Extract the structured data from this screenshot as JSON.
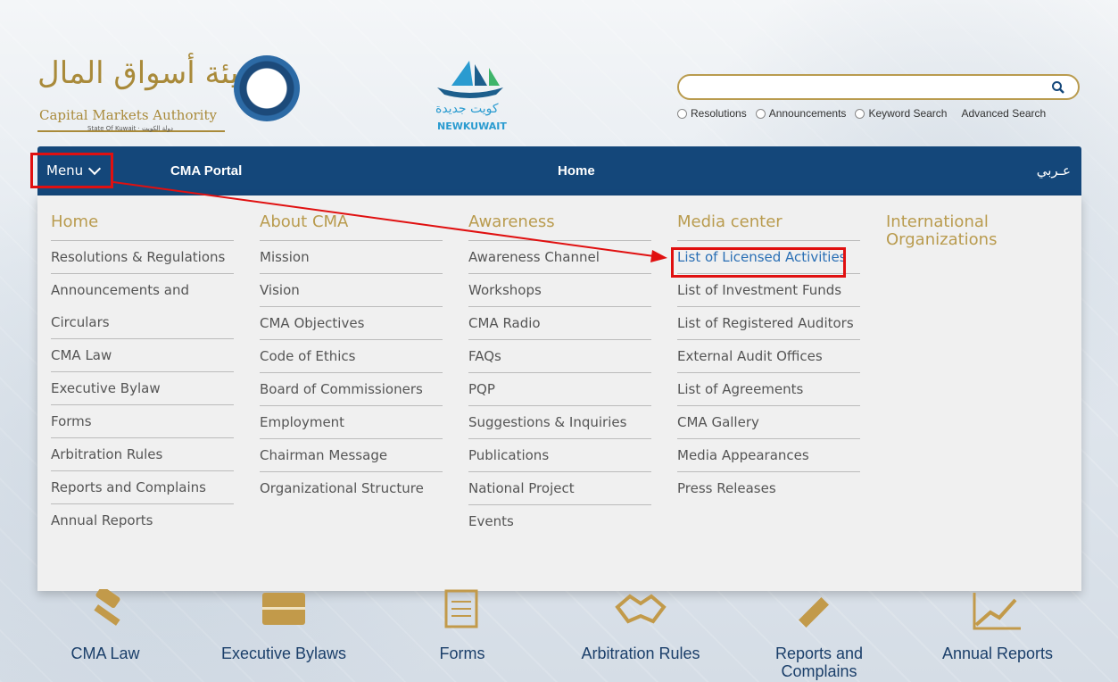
{
  "header": {
    "logo_ar": "هيئة أسواق المال",
    "logo_en": "Capital Markets Authority",
    "logo_sub": "State Of Kuwait · دولة الكويت",
    "newkuwait_ar": "كويت جديدة",
    "newkuwait_en": "NEWKUWAIT"
  },
  "search": {
    "placeholder": "",
    "options": [
      "Resolutions",
      "Announcements",
      "Keyword Search"
    ],
    "advanced": "Advanced Search"
  },
  "nav": {
    "menu": "Menu",
    "portal": "CMA Portal",
    "home": "Home",
    "arabic": "عـربي"
  },
  "dropdown": {
    "home": {
      "title": "Home",
      "items": [
        "Resolutions & Regulations",
        "Announcements and Circulars",
        "CMA Law",
        "Executive Bylaw",
        "Forms",
        "Arbitration Rules",
        "Reports and Complains",
        "Annual Reports"
      ]
    },
    "about": {
      "title": "About CMA",
      "items": [
        "Mission",
        "Vision",
        "CMA Objectives",
        "Code of Ethics",
        "Board of Commissioners",
        "Employment",
        "Chairman Message",
        "Organizational Structure"
      ]
    },
    "awareness": {
      "title": "Awareness",
      "items": [
        "Awareness Channel",
        "Workshops",
        "CMA Radio",
        "FAQs",
        "PQP",
        "Suggestions & Inquiries",
        "Publications",
        "National Project",
        "Events"
      ]
    },
    "media": {
      "title": "Media center",
      "items": [
        "List of Licensed Activities",
        "List of Investment Funds",
        "List of Registered Auditors",
        "External Audit Offices",
        "List of Agreements",
        "CMA Gallery",
        "Media Appearances",
        "Press Releases"
      ]
    },
    "intl": {
      "title": "International Organizations"
    }
  },
  "quick_links": [
    "CMA Law",
    "Executive Bylaws",
    "Forms",
    "Arbitration Rules",
    "Reports and Complains",
    "Annual Reports"
  ],
  "colors": {
    "nav": "#14477a",
    "gold": "#b99b4e",
    "highlight": "#e01010",
    "link": "#2a6fb5"
  }
}
